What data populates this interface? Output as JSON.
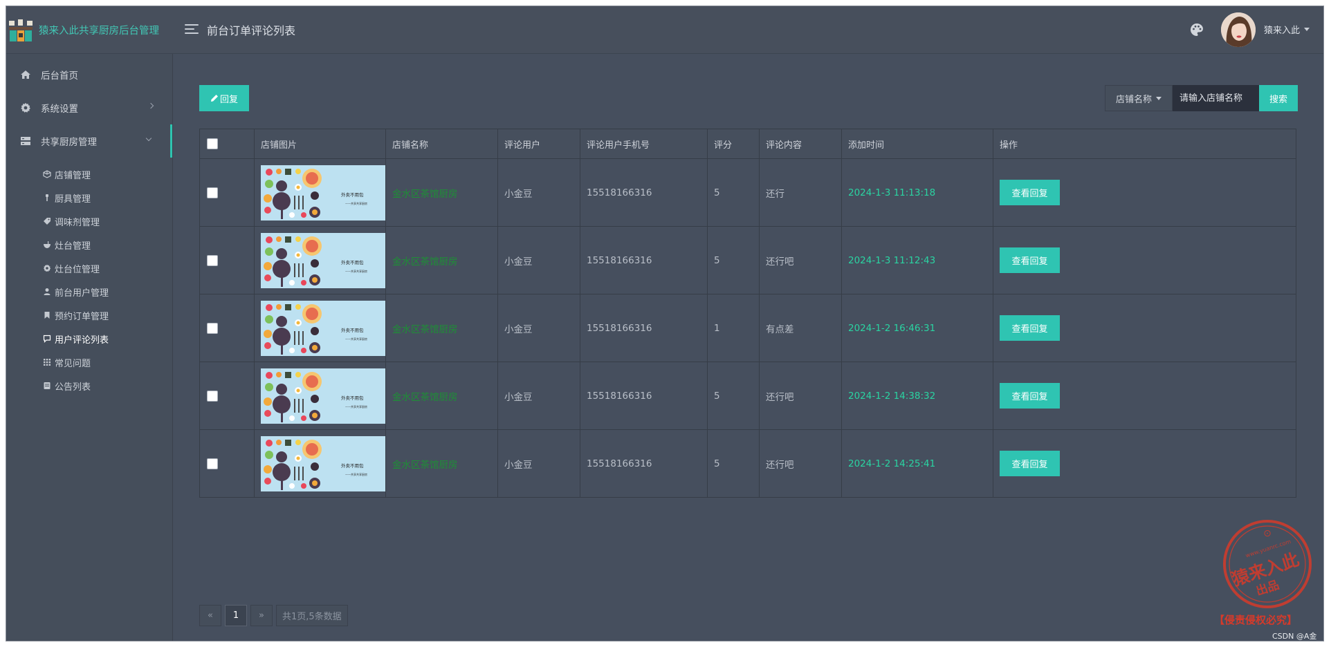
{
  "brand": {
    "name": "猿来入此共享厨房后台管理"
  },
  "header": {
    "title": "前台订单评论列表",
    "username": "猿来入此"
  },
  "sidebar": {
    "items": [
      {
        "label": "后台首页",
        "icon": "home-icon"
      },
      {
        "label": "系统设置",
        "icon": "gear-icon"
      },
      {
        "label": "共享厨房管理",
        "icon": "server-icon"
      }
    ],
    "sub_items": [
      {
        "label": "店铺管理",
        "icon": "cube-icon"
      },
      {
        "label": "厨具管理",
        "icon": "tool-icon"
      },
      {
        "label": "调味剂管理",
        "icon": "tag-icon"
      },
      {
        "label": "灶台管理",
        "icon": "bowl-icon"
      },
      {
        "label": "灶台位管理",
        "icon": "gear-icon"
      },
      {
        "label": "前台用户管理",
        "icon": "user-icon"
      },
      {
        "label": "预约订单管理",
        "icon": "bookmark-icon"
      },
      {
        "label": "用户评论列表",
        "icon": "comment-icon"
      },
      {
        "label": "常见问题",
        "icon": "grid-icon"
      },
      {
        "label": "公告列表",
        "icon": "list-icon"
      }
    ]
  },
  "toolbar": {
    "reply_label": "回复",
    "store_select": "店铺名称",
    "search_placeholder": "请输入店铺名称",
    "search_label": "搜索"
  },
  "table": {
    "headers": [
      "店铺图片",
      "店铺名称",
      "评论用户",
      "评论用户手机号",
      "评分",
      "评论内容",
      "添加时间",
      "操作"
    ],
    "thumb_text": [
      "外卖不用包",
      "——共享共享厨房"
    ],
    "rows": [
      {
        "store": "金水区茶馆厨房",
        "user": "小金豆",
        "phone": "15518166316",
        "score": "5",
        "content": "还行",
        "time": "2024-1-3 11:13:18",
        "action": "查看回复"
      },
      {
        "store": "金水区茶馆厨房",
        "user": "小金豆",
        "phone": "15518166316",
        "score": "5",
        "content": "还行吧",
        "time": "2024-1-3 11:12:43",
        "action": "查看回复"
      },
      {
        "store": "金水区茶馆厨房",
        "user": "小金豆",
        "phone": "15518166316",
        "score": "1",
        "content": "有点差",
        "time": "2024-1-2 16:46:31",
        "action": "查看回复"
      },
      {
        "store": "金水区茶馆厨房",
        "user": "小金豆",
        "phone": "15518166316",
        "score": "5",
        "content": "还行吧",
        "time": "2024-1-2 14:38:32",
        "action": "查看回复"
      },
      {
        "store": "金水区茶馆厨房",
        "user": "小金豆",
        "phone": "15518166316",
        "score": "5",
        "content": "还行吧",
        "time": "2024-1-2 14:25:41",
        "action": "查看回复"
      }
    ]
  },
  "pagination": {
    "prev": "«",
    "page": "1",
    "next": "»",
    "summary": "共1页,5条数据"
  },
  "watermark": {
    "stamp_text": "猿来入此",
    "stamp_sub": "出品",
    "stamp_url": "www.yuanrc.com",
    "caption": "【侵责侵权必究】",
    "credit": "CSDN @A金小"
  },
  "colors": {
    "accent": "#2fc4b2",
    "brand": "#42c7b5",
    "store_name": "#1e8f36",
    "time": "#2ad4a2",
    "stamp": "#d63a2a"
  }
}
